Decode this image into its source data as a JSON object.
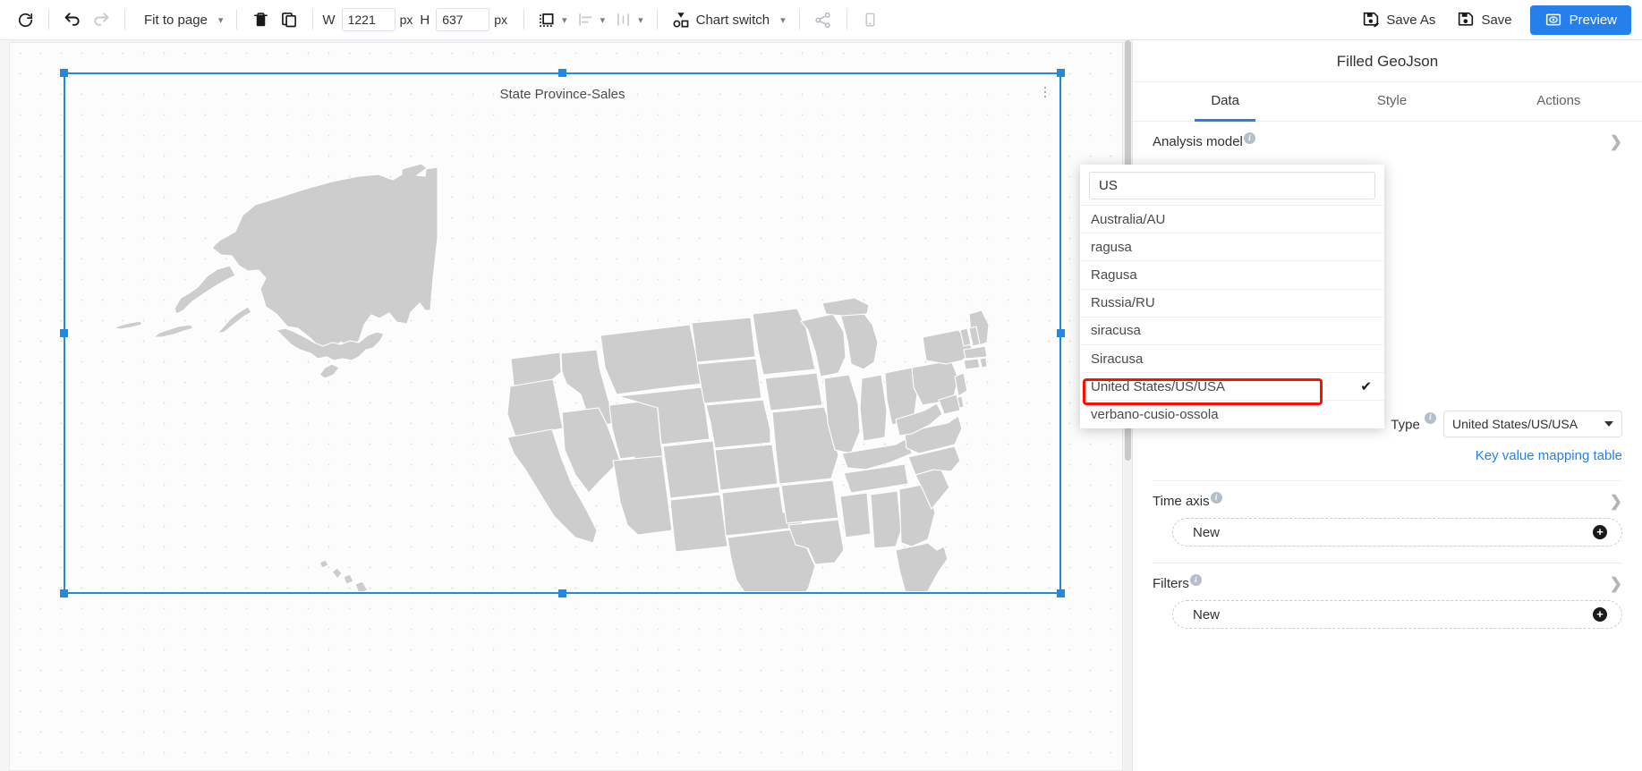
{
  "toolbar": {
    "refresh_label": "refresh",
    "undo_label": "undo",
    "redo_label": "redo",
    "zoom_mode": "Fit to page",
    "delete_label": "delete",
    "copy_label": "copy",
    "width_letter": "W",
    "width_value": "1221",
    "height_letter": "H",
    "height_value": "637",
    "unit_px": "px",
    "chart_switch": "Chart switch",
    "share_label": "share",
    "mobile_label": "mobile preview",
    "save_as": "Save As",
    "save": "Save",
    "preview": "Preview",
    "accent_color": "#2680EB"
  },
  "canvas": {
    "chart_title": "State Province-Sales",
    "widget_menu": "more-options"
  },
  "panel": {
    "title": "Filled GeoJson",
    "tabs": [
      {
        "label": "Data",
        "active": true
      },
      {
        "label": "Style",
        "active": false
      },
      {
        "label": "Actions",
        "active": false
      }
    ],
    "analysis_model_label": "Analysis model",
    "type_label": "Type",
    "type_value": "United States/US/USA",
    "key_value_mapping": "Key value mapping table",
    "time_axis_label": "Time axis",
    "time_axis_new": "New",
    "filters_label": "Filters",
    "filters_new": "New",
    "info_glyph": "i"
  },
  "dropdown": {
    "search_value": "US",
    "options": [
      {
        "label": "Australia/AU",
        "selected": false
      },
      {
        "label": "ragusa",
        "selected": false
      },
      {
        "label": "Ragusa",
        "selected": false
      },
      {
        "label": "Russia/RU",
        "selected": false
      },
      {
        "label": "siracusa",
        "selected": false
      },
      {
        "label": "Siracusa",
        "selected": false
      },
      {
        "label": "United States/US/USA",
        "selected": true
      },
      {
        "label": "verbano-cusio-ossola",
        "selected": false
      }
    ],
    "check_glyph": "✔",
    "highlight_color": "#fb1102"
  }
}
